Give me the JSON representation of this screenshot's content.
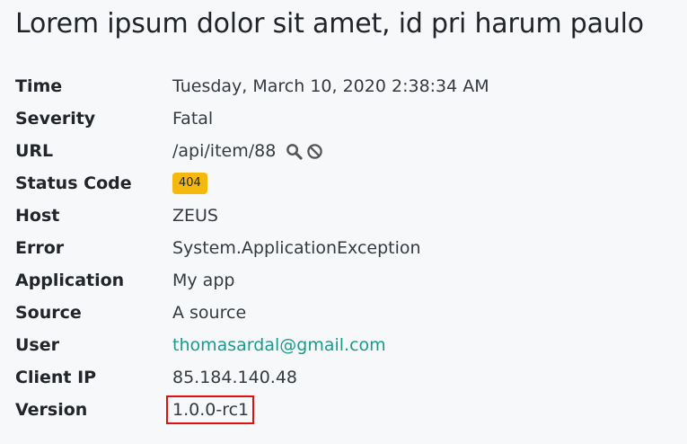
{
  "title": "Lorem ipsum dolor sit amet, id pri harum paulo",
  "fields": {
    "time": {
      "label": "Time",
      "value": "Tuesday, March 10, 2020 2:38:34 AM"
    },
    "severity": {
      "label": "Severity",
      "value": "Fatal"
    },
    "url": {
      "label": "URL",
      "value": "/api/item/88"
    },
    "status_code": {
      "label": "Status Code",
      "value": "404"
    },
    "host": {
      "label": "Host",
      "value": "ZEUS"
    },
    "error": {
      "label": "Error",
      "value": "System.ApplicationException"
    },
    "application": {
      "label": "Application",
      "value": "My app"
    },
    "source": {
      "label": "Source",
      "value": "A source"
    },
    "user": {
      "label": "User",
      "value": "thomasardal@gmail.com"
    },
    "client_ip": {
      "label": "Client IP",
      "value": "85.184.140.48"
    },
    "version": {
      "label": "Version",
      "value": "1.0.0-rc1"
    }
  },
  "icons": {
    "url_search": "search-icon",
    "url_ignore": "ban-icon"
  },
  "colors": {
    "badge": "#f5b80c",
    "link": "#1a9b8a",
    "highlight_border": "#e01010"
  }
}
